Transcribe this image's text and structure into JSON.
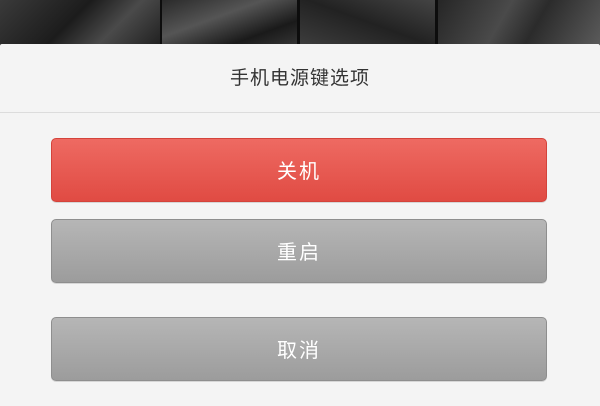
{
  "dialog": {
    "title": "手机电源键选项",
    "buttons": {
      "shutdown_label": "关机",
      "restart_label": "重启",
      "cancel_label": "取消"
    }
  },
  "colors": {
    "shutdown_button": "#e5534b",
    "secondary_button": "#a9a9a9",
    "sheet_background": "#f4f4f4",
    "title_text": "#333333",
    "button_text": "#ffffff"
  }
}
